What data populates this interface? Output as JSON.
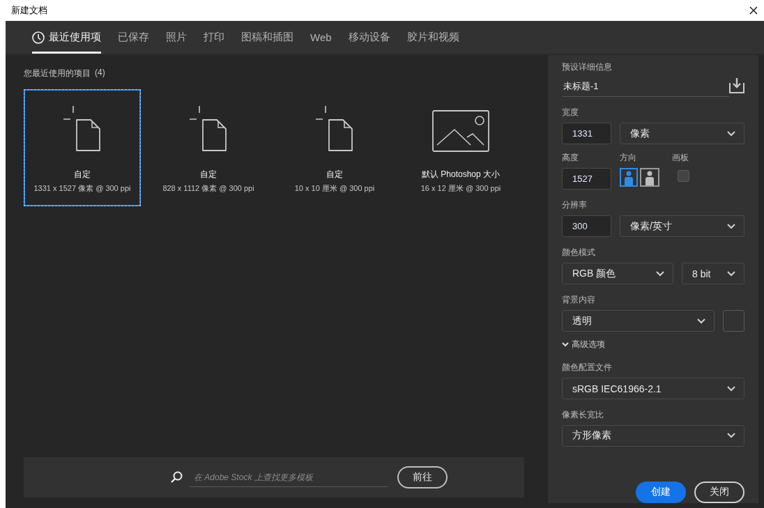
{
  "window": {
    "title": "新建文档"
  },
  "tabs": [
    {
      "label": "最近使用项",
      "selected": true,
      "kind": "recent"
    },
    {
      "label": "已保存",
      "selected": false
    },
    {
      "label": "照片",
      "selected": false
    },
    {
      "label": "打印",
      "selected": false
    },
    {
      "label": "图稿和插图",
      "selected": false
    },
    {
      "label": "Web",
      "selected": false
    },
    {
      "label": "移动设备",
      "selected": false
    },
    {
      "label": "胶片和视频",
      "selected": false
    }
  ],
  "recent": {
    "heading": "您最近使用的项目",
    "count": "(4)",
    "items": [
      {
        "name": "自定",
        "size": "1331 x 1527 像素 @ 300 ppi",
        "selected": true,
        "kind": "blank"
      },
      {
        "name": "自定",
        "size": "828 x 1112 像素 @ 300 ppi",
        "selected": false,
        "kind": "blank"
      },
      {
        "name": "自定",
        "size": "10 x 10 厘米 @ 300 ppi",
        "selected": false,
        "kind": "blank"
      },
      {
        "name": "默认 Photoshop 大小",
        "size": "16 x 12 厘米 @ 300 ppi",
        "selected": false,
        "kind": "image"
      }
    ]
  },
  "stock": {
    "placeholder": "在 Adobe Stock 上查找更多模板",
    "button": "前往"
  },
  "details": {
    "heading": "预设详细信息",
    "name": "未标题-1",
    "width": {
      "label": "宽度",
      "value": "1331",
      "unit": "像素"
    },
    "height": {
      "label": "高度",
      "value": "1527"
    },
    "orientation": {
      "label": "方向",
      "options": [
        {
          "kind": "portrait",
          "selected": true
        },
        {
          "kind": "landscape",
          "selected": false
        }
      ]
    },
    "artboard": {
      "label": "画板",
      "checked": false
    },
    "resolution": {
      "label": "分辨率",
      "value": "300",
      "unit": "像素/英寸"
    },
    "color_mode": {
      "label": "颜色模式",
      "mode": "RGB 颜色",
      "depth": "8 bit"
    },
    "background": {
      "label": "背景内容",
      "value": "透明"
    },
    "advanced": {
      "label": "高级选项",
      "expanded": true
    },
    "color_profile": {
      "label": "颜色配置文件",
      "value": "sRGB IEC61966-2.1"
    },
    "pixel_aspect": {
      "label": "像素长宽比",
      "value": "方形像素"
    },
    "buttons": [
      {
        "label": "创建",
        "kind": "primary"
      },
      {
        "label": "关闭",
        "kind": "secondary"
      }
    ]
  }
}
